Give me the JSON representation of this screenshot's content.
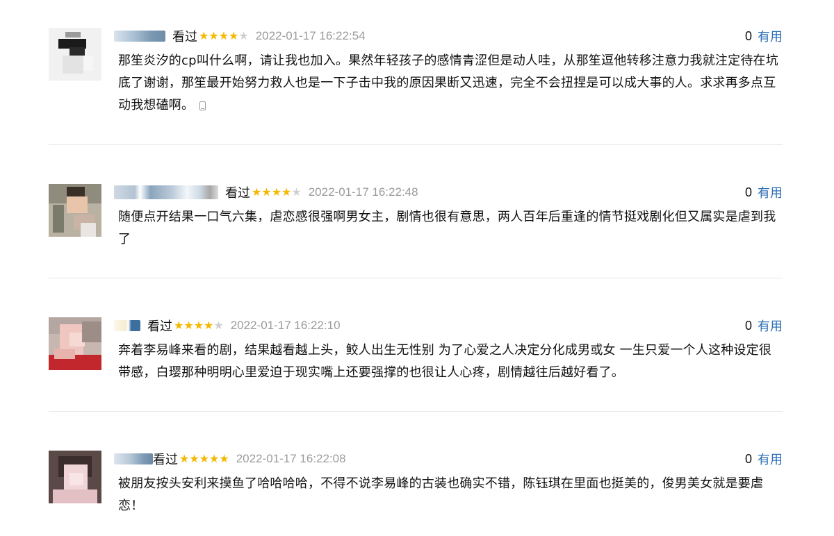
{
  "reviews": [
    {
      "status": "看过",
      "rating": 4,
      "time": "2022-01-17 16:22:54",
      "votes": "0",
      "useful_label": "有用",
      "content": "那笙炎汐的cp叫什么啊，请让我也加入。果然年轻孩子的感情青涩但是动人哇，从那笙逗他转移注意力我就注定待在坑底了谢谢，那笙最开始努力救人也是一下子击中我的原因果断又迅速，完全不会扭捏是可以成大事的人。求求再多点互动我想磕啊。",
      "source_icon": "phone-icon"
    },
    {
      "status": "看过",
      "rating": 4,
      "time": "2022-01-17 16:22:48",
      "votes": "0",
      "useful_label": "有用",
      "content": "随便点开结果一口气六集，虐恋感很强啊男女主，剧情也很有意思，两人百年后重逢的情节挺戏剧化但又属实是虐到我了"
    },
    {
      "status": "看过",
      "rating": 4,
      "time": "2022-01-17 16:22:10",
      "votes": "0",
      "useful_label": "有用",
      "content": "奔着李易峰来看的剧，结果越看越上头，鲛人出生无性别 为了心爱之人决定分化成男或女 一生只爱一个人这种设定很带感，白璎那种明明心里爱迫于现实嘴上还要强撑的也很让人心疼，剧情越往后越好看了。"
    },
    {
      "status": "看过",
      "rating": 5,
      "time": "2022-01-17 16:22:08",
      "votes": "0",
      "useful_label": "有用",
      "content": "被朋友按头安利来摸鱼了哈哈哈哈，不得不说李易峰的古装也确实不错，陈钰琪在里面也挺美的，俊男美女就是要虐恋！"
    }
  ],
  "colors": {
    "star_on": "#f5b800",
    "star_off": "#cfcfcf",
    "link": "#2d6fb6",
    "time": "#9b9b9b",
    "divider": "#e6e6e6"
  }
}
